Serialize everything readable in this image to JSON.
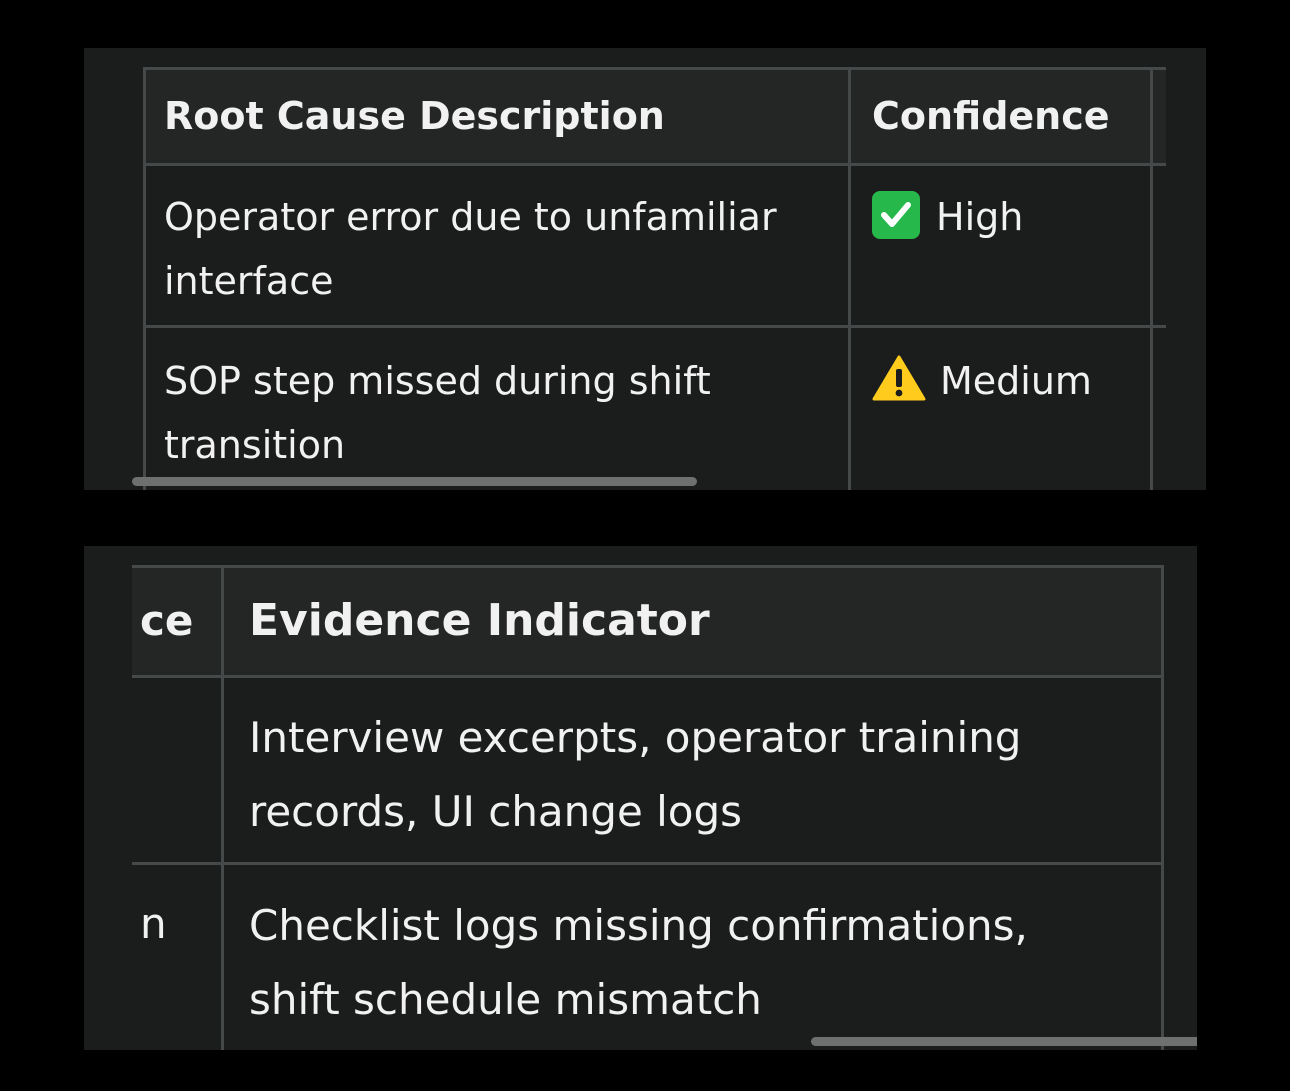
{
  "table_top": {
    "headers": [
      "Root Cause Description",
      "Confidence"
    ],
    "rows": [
      {
        "description": "Operator error due to unfamiliar interface",
        "confidence": "High",
        "confidence_icon": "check-mark-icon"
      },
      {
        "description": "SOP step missed during shift transition",
        "confidence": "Medium",
        "confidence_icon": "warning-icon"
      }
    ]
  },
  "table_bottom": {
    "partial_col_header": "ce",
    "header": "Evidence Indicator",
    "rows": [
      {
        "partial": "",
        "evidence": "Interview excerpts, operator training records, UI change logs"
      },
      {
        "partial": "n",
        "evidence": "Checklist logs missing confirmations, shift schedule mismatch"
      }
    ]
  },
  "colors": {
    "background": "#000000",
    "panel": "#1b1c1c",
    "header_bg": "#242626",
    "grid": "#464949",
    "text": "#f1f1f1",
    "check_green": "#26b84a",
    "warning_yellow": "#ffcc1e"
  }
}
